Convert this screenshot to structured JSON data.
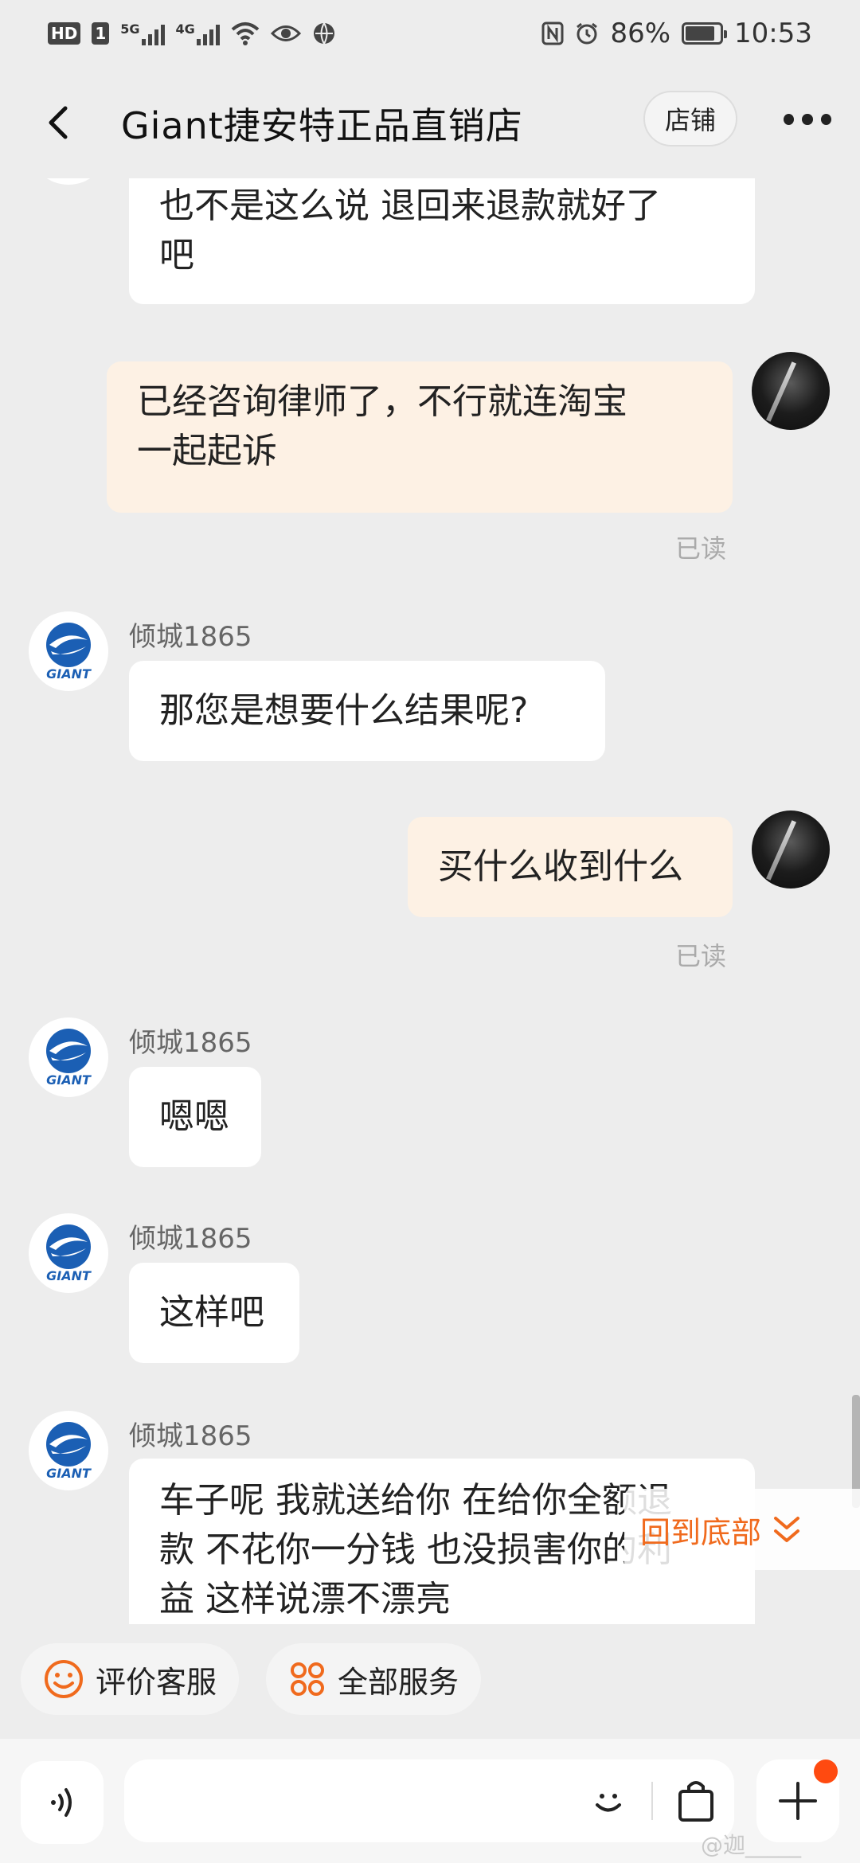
{
  "status_bar": {
    "left_chips": [
      "HD",
      "1"
    ],
    "net1": "5G",
    "net2": "4G",
    "battery_pct": "86%",
    "battery_level": 0.86,
    "time": "10:53",
    "icons": [
      "hd-icon",
      "sim-icon",
      "signal-5g-icon",
      "signal-4g-icon",
      "wifi-icon",
      "eye-icon",
      "vpn-globe-icon",
      "nfc-icon",
      "alarm-icon",
      "battery-icon"
    ]
  },
  "header": {
    "title": "Giant捷安特正品直销店",
    "shop_button": "店铺"
  },
  "messages": [
    {
      "type": "incoming_partial",
      "text_lines": [
        "也不是这么说 退回来退款就好了",
        "吧"
      ]
    },
    {
      "type": "outgoing",
      "text_lines": [
        "已经咨询律师了，不行就连淘宝",
        "一起起诉"
      ],
      "read": "已读"
    },
    {
      "type": "incoming",
      "sender": "倾城1865",
      "text_lines": [
        "那您是想要什么结果呢?"
      ]
    },
    {
      "type": "outgoing",
      "text_lines": [
        "买什么收到什么"
      ],
      "read": "已读"
    },
    {
      "type": "incoming",
      "sender": "倾城1865",
      "text_lines": [
        "嗯嗯"
      ]
    },
    {
      "type": "incoming",
      "sender": "倾城1865",
      "text_lines": [
        "这样吧"
      ]
    },
    {
      "type": "incoming_partial",
      "sender": "倾城1865",
      "text_lines": [
        "车子呢 我就送给你 在给你全额退",
        "款  不花你一分钱 也没损害你的利",
        "益 这样说漂不漂亮"
      ]
    }
  ],
  "back_to_bottom": "回到底部",
  "quick_actions": [
    {
      "label": "评价客服",
      "icon": "smiley-icon"
    },
    {
      "label": "全部服务",
      "icon": "grid-icon"
    }
  ],
  "input": {
    "value": "",
    "placeholder": ""
  },
  "accent_color": "#f06a1d",
  "watermark": "@迦_____"
}
